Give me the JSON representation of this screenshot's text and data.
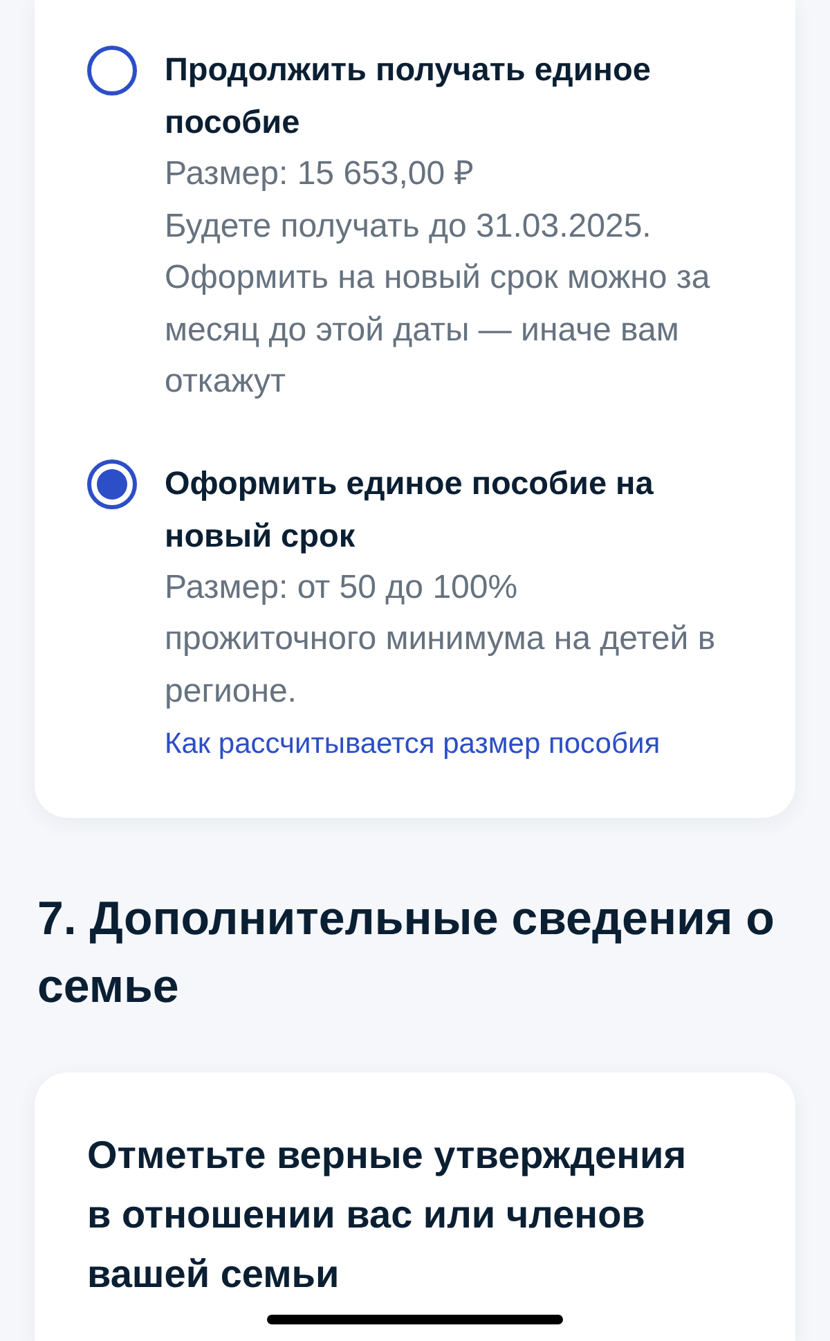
{
  "options": [
    {
      "title": "Продолжить получать единое пособие",
      "selected": false,
      "details": [
        "Размер: 15 653,00 ₽",
        "Будете получать до 31.03.2025.",
        "Оформить на новый срок можно за месяц до этой даты — иначе вам откажут"
      ]
    },
    {
      "title": "Оформить единое пособие на новый срок",
      "selected": true,
      "details": [
        "Размер: от 50 до 100% прожиточного минимума на детей в регионе."
      ],
      "link": "Как рассчитывается размер пособия"
    }
  ],
  "section": {
    "title": "7. Дополнительные сведения о семье"
  },
  "card": {
    "title": "Отметьте верные утверждения в отношении вас или членов вашей семьи"
  }
}
